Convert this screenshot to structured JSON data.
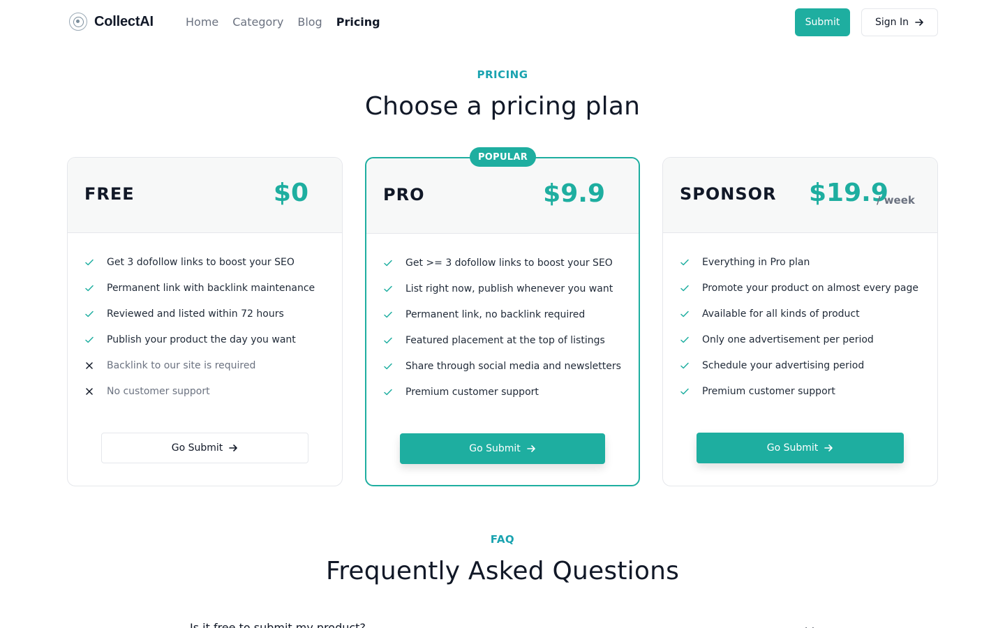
{
  "brand": {
    "name": "CollectAI"
  },
  "nav": [
    {
      "label": "Home",
      "active": false
    },
    {
      "label": "Category",
      "active": false
    },
    {
      "label": "Blog",
      "active": false
    },
    {
      "label": "Pricing",
      "active": true
    }
  ],
  "header": {
    "submit_label": "Submit",
    "signin_label": "Sign In"
  },
  "pricing": {
    "eyebrow": "PRICING",
    "title": "Choose a pricing plan"
  },
  "plans": [
    {
      "name": "FREE",
      "price": "$0",
      "period": "",
      "badge": "",
      "features": [
        {
          "text": "Get 3 dofollow links to boost your SEO",
          "included": true
        },
        {
          "text": "Permanent link with backlink maintenance",
          "included": true
        },
        {
          "text": "Reviewed and listed within 72 hours",
          "included": true
        },
        {
          "text": "Publish your product the day you want",
          "included": true
        },
        {
          "text": "Backlink to our site is required",
          "included": false
        },
        {
          "text": "No customer support",
          "included": false
        }
      ],
      "button": "Go Submit"
    },
    {
      "name": "PRO",
      "price": "$9.9",
      "period": "",
      "badge": "POPULAR",
      "features": [
        {
          "text": "Get >= 3 dofollow links to boost your SEO",
          "included": true
        },
        {
          "text": "List right now, publish whenever you want",
          "included": true
        },
        {
          "text": "Permanent link, no backlink required",
          "included": true
        },
        {
          "text": "Featured placement at the top of listings",
          "included": true
        },
        {
          "text": "Share through social media and newsletters",
          "included": true
        },
        {
          "text": "Premium customer support",
          "included": true
        }
      ],
      "button": "Go Submit"
    },
    {
      "name": "SPONSOR",
      "price": "$19.9",
      "period": "/ week",
      "badge": "",
      "features": [
        {
          "text": "Everything in Pro plan",
          "included": true
        },
        {
          "text": "Promote your product on almost every page",
          "included": true
        },
        {
          "text": "Available for all kinds of product",
          "included": true
        },
        {
          "text": "Only one advertisement per period",
          "included": true
        },
        {
          "text": "Schedule your advertising period",
          "included": true
        },
        {
          "text": "Premium customer support",
          "included": true
        }
      ],
      "button": "Go Submit"
    }
  ],
  "faq": {
    "eyebrow": "FAQ",
    "title": "Frequently Asked Questions",
    "first_question": "Is it free to submit my product?"
  },
  "colors": {
    "accent": "#1eaea0",
    "eyebrow": "#1aa3b0",
    "text": "#111827",
    "muted": "#6b7280"
  },
  "icons": {
    "check": "check-icon",
    "cross": "x-icon",
    "arrow": "arrow-right-icon",
    "chevron": "chevron-down-icon",
    "logo": "brain-logo-icon"
  }
}
